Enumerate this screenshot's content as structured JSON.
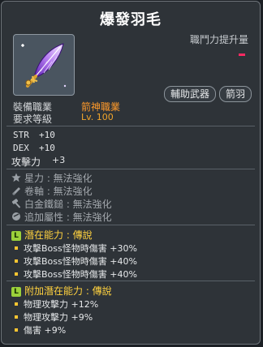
{
  "item": {
    "name": "爆發羽毛",
    "attack_increase_label": "職鬥力提升量",
    "category_tags": [
      "輔助武器",
      "箭羽"
    ],
    "requirements": [
      {
        "label": "裝備職業",
        "value": "箭神職業"
      },
      {
        "label": "要求等級",
        "value": "Lv. 100"
      }
    ],
    "stats": [
      {
        "label": "STR",
        "value": "+10"
      },
      {
        "label": "DEX",
        "value": "+10"
      }
    ],
    "attack": {
      "label": "攻擊力",
      "value": "+3"
    },
    "enhancements": [
      {
        "icon": "star-icon",
        "text": "星力 : 無法強化"
      },
      {
        "icon": "scroll-icon",
        "text": "卷軸 : 無法強化"
      },
      {
        "icon": "hammer-icon",
        "text": "白金鐵鎚 : 無法強化"
      },
      {
        "icon": "gem-icon",
        "text": "追加屬性 : 無法強化"
      }
    ],
    "potential": {
      "badge": "L",
      "title": "潛在能力 : 傳說",
      "lines": [
        "攻擊Boss怪物時傷害 +30%",
        "攻擊Boss怪物時傷害 +40%",
        "攻擊Boss怪物時傷害 +40%"
      ]
    },
    "additional_potential": {
      "badge": "L",
      "title": "附加潛在能力 : 傳說",
      "lines": [
        "物理攻擊力 +12%",
        "物理攻擊力 +9%",
        "傷害 +9%"
      ]
    }
  },
  "colors": {
    "accent_orange": "#ff9a2a",
    "potential_title": "#ffd23f",
    "legendary_badge": "#9bd13a",
    "attack_dash": "#ff2a62"
  }
}
